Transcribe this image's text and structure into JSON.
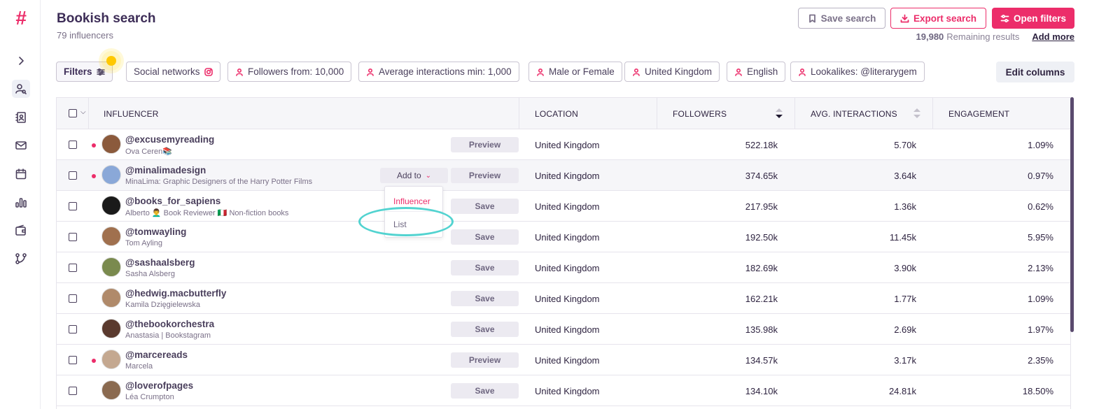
{
  "app": {
    "logo": "#",
    "title": "Bookish search",
    "subtitle": "79 influencers"
  },
  "toolbar": {
    "save_search": "Save search",
    "export_search": "Export search",
    "open_filters": "Open filters",
    "remaining_count": "19,980",
    "remaining_label": "Remaining results",
    "add_more": "Add more",
    "edit_columns": "Edit columns"
  },
  "filters": {
    "filters_label": "Filters",
    "chips": [
      "Social networks",
      "Followers from: 10,000",
      "Average interactions min: 1,000",
      "Male or Female",
      "United Kingdom",
      "English",
      "Lookalikes: @literarygem"
    ]
  },
  "sidebar": {
    "icons": [
      "expand-icon",
      "user-search-icon",
      "contacts-icon",
      "mail-icon",
      "calendar-icon",
      "bar-chart-icon",
      "wallet-icon",
      "workflow-icon"
    ]
  },
  "table": {
    "columns": {
      "influencer": "INFLUENCER",
      "location": "LOCATION",
      "followers": "FOLLOWERS",
      "avg_interactions": "AVG. INTERACTIONS",
      "engagement": "ENGAGEMENT"
    },
    "rows": [
      {
        "handle": "@excusemyreading",
        "desc": "Ova Ceren📚",
        "action": "Preview",
        "location": "United Kingdom",
        "followers": "522.18k",
        "avg": "5.70k",
        "eng": "1.09%",
        "dot": true,
        "avatar_color": "#8b5a3c"
      },
      {
        "handle": "@minalimadesign",
        "desc": "MinaLima: Graphic Designers of the Harry Potter Films",
        "action": "Preview",
        "add_to": "Add to",
        "location": "United Kingdom",
        "followers": "374.65k",
        "avg": "3.64k",
        "eng": "0.97%",
        "dot": true,
        "avatar_color": "#8aa8d8"
      },
      {
        "handle": "@books_for_sapiens",
        "desc": "Alberto 👨‍🦱 Book Reviewer 🇮🇹 Non-fiction books",
        "action": "Save",
        "location": "United Kingdom",
        "followers": "217.95k",
        "avg": "1.36k",
        "eng": "0.62%",
        "dot": false,
        "avatar_color": "#1a1a1a"
      },
      {
        "handle": "@tomwayling",
        "desc": "Tom Ayling",
        "action": "Save",
        "location": "United Kingdom",
        "followers": "192.50k",
        "avg": "11.45k",
        "eng": "5.95%",
        "dot": false,
        "avatar_color": "#a0704e"
      },
      {
        "handle": "@sashaalsberg",
        "desc": "Sasha Alsberg",
        "action": "Save",
        "location": "United Kingdom",
        "followers": "182.69k",
        "avg": "3.90k",
        "eng": "2.13%",
        "dot": false,
        "avatar_color": "#7a8a4e"
      },
      {
        "handle": "@hedwig.macbutterfly",
        "desc": "Kamila Dzięgielewska",
        "action": "Save",
        "location": "United Kingdom",
        "followers": "162.21k",
        "avg": "1.77k",
        "eng": "1.09%",
        "dot": false,
        "avatar_color": "#b08a6a"
      },
      {
        "handle": "@thebookorchestra",
        "desc": "Anastasia | Bookstagram",
        "action": "Save",
        "location": "United Kingdom",
        "followers": "135.98k",
        "avg": "2.69k",
        "eng": "1.97%",
        "dot": false,
        "avatar_color": "#5a3a2e"
      },
      {
        "handle": "@marcereads",
        "desc": "Marcela",
        "action": "Preview",
        "location": "United Kingdom",
        "followers": "134.57k",
        "avg": "3.17k",
        "eng": "2.35%",
        "dot": true,
        "avatar_color": "#c4a890"
      },
      {
        "handle": "@loverofpages",
        "desc": "Léa Crumpton",
        "action": "Save",
        "location": "United Kingdom",
        "followers": "134.10k",
        "avg": "24.81k",
        "eng": "18.50%",
        "dot": false,
        "avatar_color": "#8a6a50"
      }
    ]
  },
  "dropdown": {
    "items": [
      "Influencer",
      "List"
    ]
  },
  "colors": {
    "accent": "#ec2d6a",
    "annotation": "#52d3d0",
    "highlight": "#ffc800"
  }
}
